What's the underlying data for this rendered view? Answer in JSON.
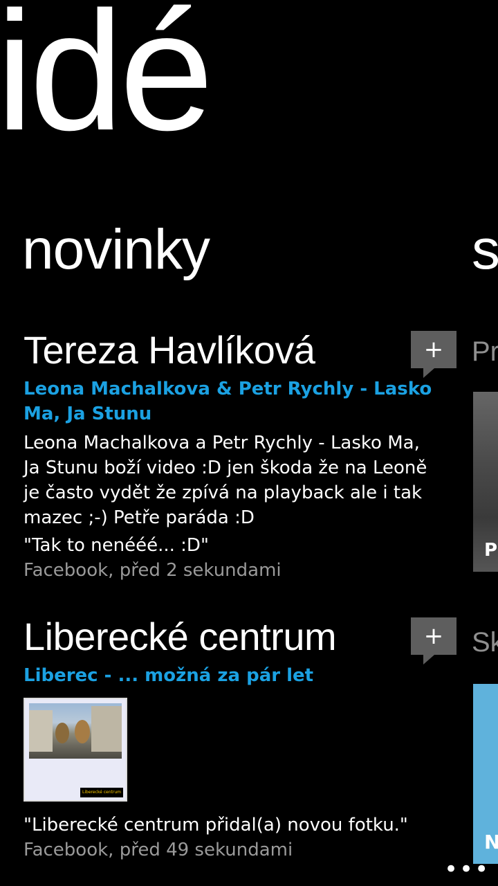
{
  "hub": {
    "title": "idé"
  },
  "sections": {
    "current_title": "novinky",
    "next_title_fragment": "s"
  },
  "feed": [
    {
      "poster": "Tereza Havlíková",
      "link_title": "Leona Machalkova & Petr Rychly - Lasko Ma, Ja Stunu",
      "body": "Leona Machalkova a Petr Rychly - Lasko Ma, Ja Stunu boží video :D jen škoda že na Leoně je často vydět že zpívá na playback ale i tak mazec ;-) Petře paráda :D",
      "quote": "\"Tak to nenééé... :D\"",
      "meta": "Facebook, před 2 sekundami",
      "comment_glyph": "+"
    },
    {
      "poster": "Liberecké centrum",
      "link_title": "Liberec - ... možná za pár let",
      "thumb_caption": "Liberecké centrum",
      "quote": "\"Liberecké centrum přidal(a) novou fotku.\"",
      "meta": "Facebook, před 49 sekundami",
      "comment_glyph": "+"
    }
  ],
  "next_panel": {
    "label1": "Pr",
    "image1_text": "Pr",
    "label2": "Sk",
    "image2_text": "N"
  },
  "appbar": {
    "more": "•••"
  }
}
